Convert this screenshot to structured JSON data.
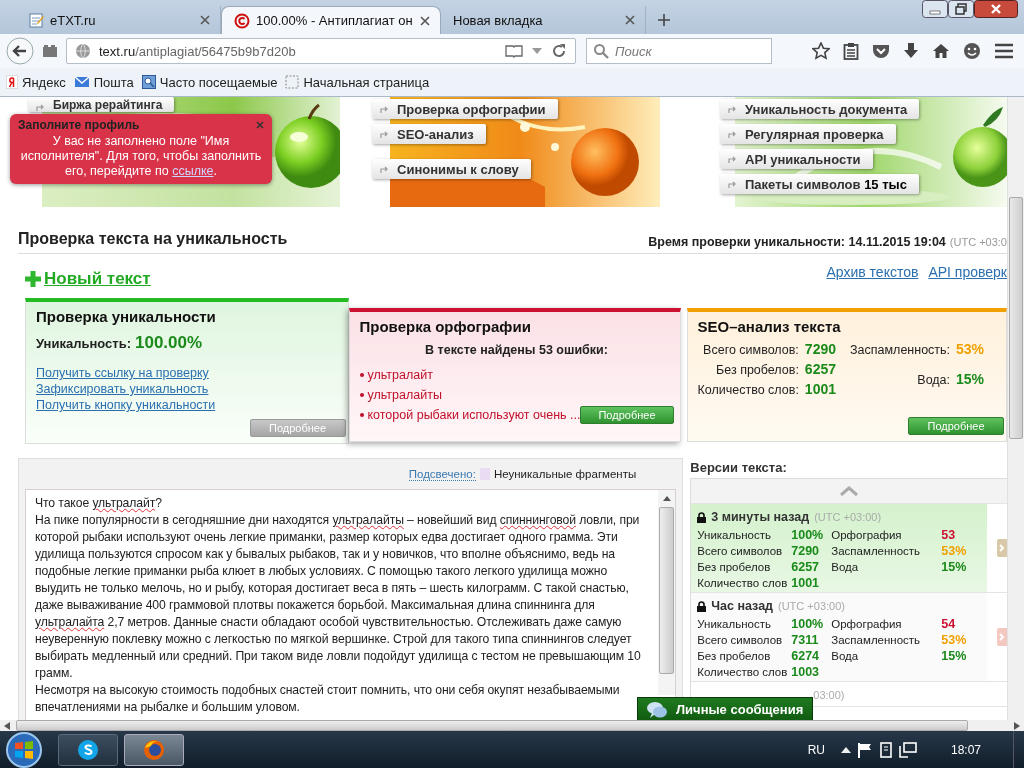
{
  "browser": {
    "tabs": [
      {
        "label": "eTXT.ru",
        "selected": false
      },
      {
        "label": "100.00% - Антиплагиат он",
        "selected": true
      },
      {
        "label": "Новая вкладка",
        "selected": false
      }
    ],
    "address": {
      "host": "text.ru",
      "path": "/antiplagiat/56475b9b7d20b"
    },
    "search": {
      "placeholder": "Поиск"
    },
    "bookmarks": [
      {
        "label": "Яндекс"
      },
      {
        "label": "Пошта"
      },
      {
        "label": "Часто посещаемые"
      },
      {
        "label": "Начальная страница"
      }
    ]
  },
  "banners": [
    {
      "items": [
        "Биржа рерайтинга"
      ]
    },
    {
      "items": [
        "Проверка орфографии",
        "SEO-анализ",
        "Синонимы к слову"
      ]
    },
    {
      "items": [
        "Уникальность документа",
        "Регулярная проверка",
        "API уникальности",
        "Пакеты символов **15 тыс**"
      ]
    }
  ],
  "notification": {
    "title": "Заполните профиль",
    "text_before": "У вас не заполнено поле \"Имя исполнителя\". Для того, чтобы заполнить его, перейдите по ",
    "link": "ссылке",
    "text_after": "."
  },
  "heading": "Проверка текста на уникальность",
  "check_time": {
    "label": "Время проверки уникальности: 14.11.2015 19:04",
    "tz": "(UTC +03:0"
  },
  "new_text": "Новый текст",
  "top_links": [
    "Архив текстов",
    "API проверк"
  ],
  "cards": [
    {
      "kind": "uniqueness",
      "title": "Проверка уникальности",
      "color": "#22bb22",
      "label": "Уникальность:",
      "value": "100.00%",
      "links": [
        "Получить ссылку на проверку",
        "Зафиксировать уникальность",
        "Получить кнопку уникальности"
      ],
      "button": {
        "label": "Подробнее",
        "disabled": true
      }
    },
    {
      "kind": "spelling",
      "title": "Проверка орфографии",
      "color": "#cc1133",
      "summary": "В тексте найдены 53 ошибки:",
      "errors": [
        "ультралайт",
        "ультралайты",
        "которой рыбаки используют очень ..."
      ],
      "button": {
        "label": "Подробнее",
        "disabled": false
      }
    },
    {
      "kind": "seo",
      "title": "SEO–анализ текста",
      "color": "#f0a000",
      "stats_left": [
        {
          "label": "Всего символов:",
          "value": "7290",
          "color": "#1a8a1a"
        },
        {
          "label": "Без пробелов:",
          "value": "6257",
          "color": "#1a8a1a"
        },
        {
          "label": "Количество слов:",
          "value": "1001",
          "color": "#1a8a1a"
        }
      ],
      "stats_right": [
        {
          "label": "Заспамленность:",
          "value": "53%",
          "color": "#f0a000"
        },
        {
          "label": "Вода:",
          "value": "15%",
          "color": "#1a8a1a"
        }
      ],
      "button": {
        "label": "Подробнее",
        "disabled": false
      }
    }
  ],
  "text_panel": {
    "legend_link": "Подсвечено:",
    "legend": "Неуникальные фрагменты",
    "paragraphs": [
      [
        {
          "text": "Что такое ",
          "misspelled": false
        },
        {
          "text": "ультралайт",
          "misspelled": true
        },
        {
          "text": "?",
          "misspelled": false
        }
      ],
      [
        {
          "text": "На пике популярности в сегодняшние дни находятся ",
          "misspelled": false
        },
        {
          "text": "ультралайты",
          "misspelled": true
        },
        {
          "text": " – новейший вид ",
          "misspelled": false
        },
        {
          "text": "спиннинговой",
          "misspelled": true
        },
        {
          "text": " ловли, при которой рыбаки используют очень легкие приманки, размер которых едва достигает одного грамма. Эти удилища пользуются спросом как у бывалых рыбаков, так и у новичков, что вполне объяснимо, ведь на подобные легкие приманки рыба клюет в любых условиях. С помощью такого легкого удилища можно выудить не только мелочь, но и рыбу, которая достигает веса в пять – шесть килограмм. С такой снастью, даже вываживание 400 граммовой плотвы покажется борьбой. Максимальная длина спиннинга для ",
          "misspelled": false
        },
        {
          "text": "ультралайта",
          "misspelled": true
        },
        {
          "text": " 2,7 метров. Данные снасти обладают особой чувствительностью. Отслеживать даже самую неуверенную поклевку можно с легкостью по мягкой вершинке. Строй для такого типа спиннингов следует выбирать медленный или средний. При таком виде ловли подойдут удилища с тестом не превышающим 10 грамм.",
          "misspelled": false
        }
      ],
      [
        {
          "text": "Несмотря на высокую стоимость подобных снастей стоит помнить, что они себя окупят незабываемыми впечатлениями на рыбалке и большим уловом.",
          "misspelled": false
        }
      ]
    ]
  },
  "versions": {
    "title": "Версии текста:",
    "items": [
      {
        "time": "3 минуты назад",
        "tz": "(UTC +03:00)",
        "selected": true,
        "stats_left": [
          {
            "label": "Уникальность",
            "value": "100%",
            "color": "#1a8a1a"
          },
          {
            "label": "Всего символов",
            "value": "7290",
            "color": "#1a8a1a"
          },
          {
            "label": "Без пробелов",
            "value": "6257",
            "color": "#1a8a1a"
          },
          {
            "label": "Количество слов",
            "value": "1001",
            "color": "#1a8a1a"
          }
        ],
        "stats_right": [
          {
            "label": "Орфография",
            "value": "53",
            "color": "#cc1133"
          },
          {
            "label": "Заспамленность",
            "value": "53%",
            "color": "#f0a000"
          },
          {
            "label": "Вода",
            "value": "15%",
            "color": "#1a8a1a"
          }
        ]
      },
      {
        "time": "Час назад",
        "tz": "(UTC +03:00)",
        "selected": false,
        "stats_left": [
          {
            "label": "Уникальность",
            "value": "100%",
            "color": "#1a8a1a"
          },
          {
            "label": "Всего символов",
            "value": "7311",
            "color": "#1a8a1a"
          },
          {
            "label": "Без пробелов",
            "value": "6274",
            "color": "#1a8a1a"
          },
          {
            "label": "Количество слов",
            "value": "1003",
            "color": "#1a8a1a"
          }
        ],
        "stats_right": [
          {
            "label": "Орфография",
            "value": "54",
            "color": "#cc1133"
          },
          {
            "label": "Заспамленность",
            "value": "53%",
            "color": "#f0a000"
          },
          {
            "label": "Вода",
            "value": "15%",
            "color": "#1a8a1a"
          }
        ]
      },
      {
        "tz": "03:00)",
        "selected": false
      }
    ]
  },
  "chat": {
    "label": "Личные сообщения"
  },
  "taskbar": {
    "apps": [
      {
        "selected": false
      },
      {
        "selected": true
      }
    ],
    "language": "RU",
    "clock": "18:07"
  }
}
